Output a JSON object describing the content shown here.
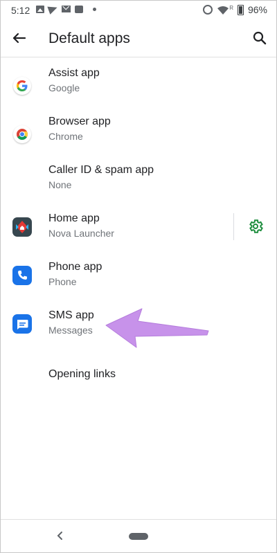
{
  "status_bar": {
    "time": "5:12",
    "network_indicator": "R",
    "battery": "96%"
  },
  "toolbar": {
    "title": "Default apps",
    "back_icon": "arrow-back-icon",
    "search_icon": "search-icon"
  },
  "items": [
    {
      "label": "Assist app",
      "value": "Google",
      "icon": "google-icon"
    },
    {
      "label": "Browser app",
      "value": "Chrome",
      "icon": "chrome-icon"
    },
    {
      "label": "Caller ID & spam app",
      "value": "None",
      "icon": ""
    },
    {
      "label": "Home app",
      "value": "Nova Launcher",
      "icon": "nova-launcher-icon",
      "action_icon": "settings-gear-icon"
    },
    {
      "label": "Phone app",
      "value": "Phone",
      "icon": "phone-icon"
    },
    {
      "label": "SMS app",
      "value": "Messages",
      "icon": "messages-icon"
    },
    {
      "label": "Opening links"
    }
  ],
  "colors": {
    "accent_green": "#1e8e3e",
    "google_blue": "#4285f4",
    "phone_blue": "#1a73e8",
    "annotation_arrow": "#c792ea"
  },
  "navigation_bar": {
    "back_icon": "nav-back-icon",
    "home_icon": "home-pill-icon"
  }
}
